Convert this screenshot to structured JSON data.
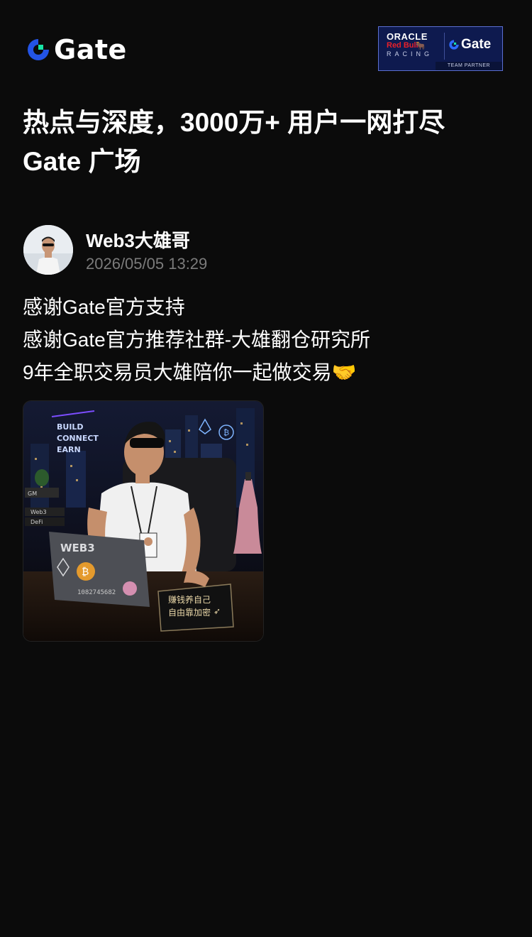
{
  "header": {
    "logo_text": "Gate",
    "partner": {
      "oracle": "ORACLE",
      "redbull": "Red Bull",
      "racing": "RACING",
      "gate": "Gate",
      "team_partner": "TEAM PARTNER"
    }
  },
  "headline": {
    "line1": "热点与深度，3000万+ 用户一网打尽",
    "line2": "Gate 广场"
  },
  "post": {
    "author": "Web3大雄哥",
    "time": "2026/05/05 13:29",
    "lines": [
      "感谢Gate官方支持",
      "感谢Gate官方推荐社群-大雄翻仓研究所",
      "9年全职交易员大雄陪你一起做交易🤝"
    ],
    "image": {
      "neon_sign": [
        "BUILD",
        "CONNECT",
        "EARN"
      ],
      "laptop_text": "WEB3",
      "laptop_number": "1082745682",
      "desk_sign": [
        "赚钱养自己",
        "自由靠加密"
      ],
      "shelf_labels": [
        "GM",
        "Web3",
        "DeFi"
      ]
    }
  },
  "colors": {
    "background": "#0b0b0b",
    "brand_blue": "#2354e6",
    "brand_green": "#17e5a6",
    "muted_text": "#7b7b7b"
  },
  "icons": [
    "gate-logo-icon",
    "avatar",
    "handshake-emoji"
  ]
}
